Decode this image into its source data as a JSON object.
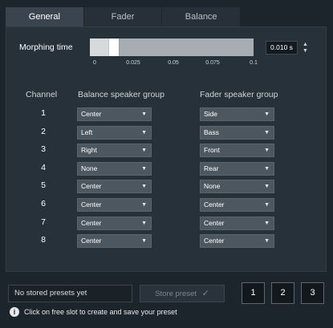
{
  "tabs": [
    "General",
    "Fader",
    "Balance"
  ],
  "morphing": {
    "label": "Morphing time",
    "value_text": "0.010 s",
    "value": 0.01,
    "range": [
      0,
      0.1
    ],
    "ticks": [
      "0",
      "0.025",
      "0.05",
      "0.075",
      "0.1"
    ]
  },
  "headers": {
    "channel": "Channel",
    "balance": "Balance speaker group",
    "fader": "Fader speaker group"
  },
  "rows": [
    {
      "channel": "1",
      "balance": "Center",
      "fader": "Side"
    },
    {
      "channel": "2",
      "balance": "Left",
      "fader": "Bass"
    },
    {
      "channel": "3",
      "balance": "Right",
      "fader": "Front"
    },
    {
      "channel": "4",
      "balance": "None",
      "fader": "Rear"
    },
    {
      "channel": "5",
      "balance": "Center",
      "fader": "None"
    },
    {
      "channel": "6",
      "balance": "Center",
      "fader": "Center"
    },
    {
      "channel": "7",
      "balance": "Center",
      "fader": "Center"
    },
    {
      "channel": "8",
      "balance": "Center",
      "fader": "Center"
    }
  ],
  "presets": {
    "input_text": "No stored presets yet",
    "store_label": "Store preset",
    "slots": [
      "1",
      "2",
      "3"
    ],
    "hint": "Click on free slot to create and save your preset"
  },
  "icons": {
    "dropdown": "chevron-down-icon",
    "spinner": "up-down-spinner-icon",
    "info": "info-icon",
    "check": "check-icon"
  },
  "colors": {
    "background": "#1d252c",
    "panel": "#27313a",
    "active_tab": "#3a444e",
    "dropdown": "#4d5760"
  }
}
